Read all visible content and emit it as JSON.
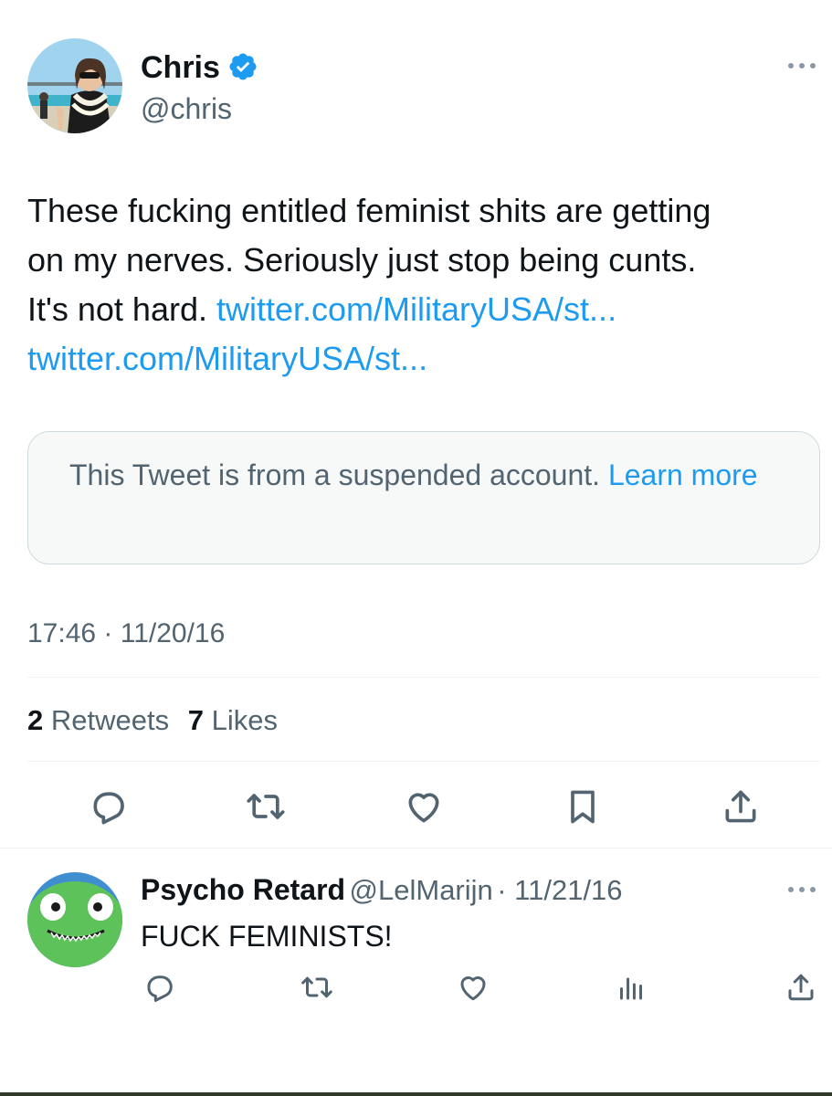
{
  "tweet": {
    "author_name": "Chris",
    "author_handle": "@chris",
    "verified": true,
    "text_line1": "These fucking entitled feminist shits are getting",
    "text_line2": "on my nerves. Seriously just stop being cunts.",
    "text_line3": "It's not hard.",
    "link1": "twitter.com/MilitaryUSA/st...",
    "link2": "twitter.com/MilitaryUSA/st...",
    "quoted_notice": "This Tweet is from a suspended account.",
    "quoted_learn_more": "Learn more",
    "timestamp": "17:46 · 11/20/16",
    "retweet_count": "2",
    "retweets_label": "Retweets",
    "like_count": "7",
    "likes_label": "Likes"
  },
  "reply": {
    "author_name": "Psycho Retard",
    "author_handle": "@LelMarijn",
    "date": "· 11/21/16",
    "text": "FUCK FEMINISTS!"
  },
  "icons": {
    "verified": "verified-badge-icon",
    "more": "more-icon",
    "reply": "reply-icon",
    "retweet": "retweet-icon",
    "like": "like-icon",
    "bookmark": "bookmark-icon",
    "share": "share-icon",
    "views": "views-icon"
  },
  "colors": {
    "accent": "#1d9bf0",
    "text_primary": "#0f1419",
    "text_secondary": "#536471",
    "card_background": "#f7f9f9"
  }
}
